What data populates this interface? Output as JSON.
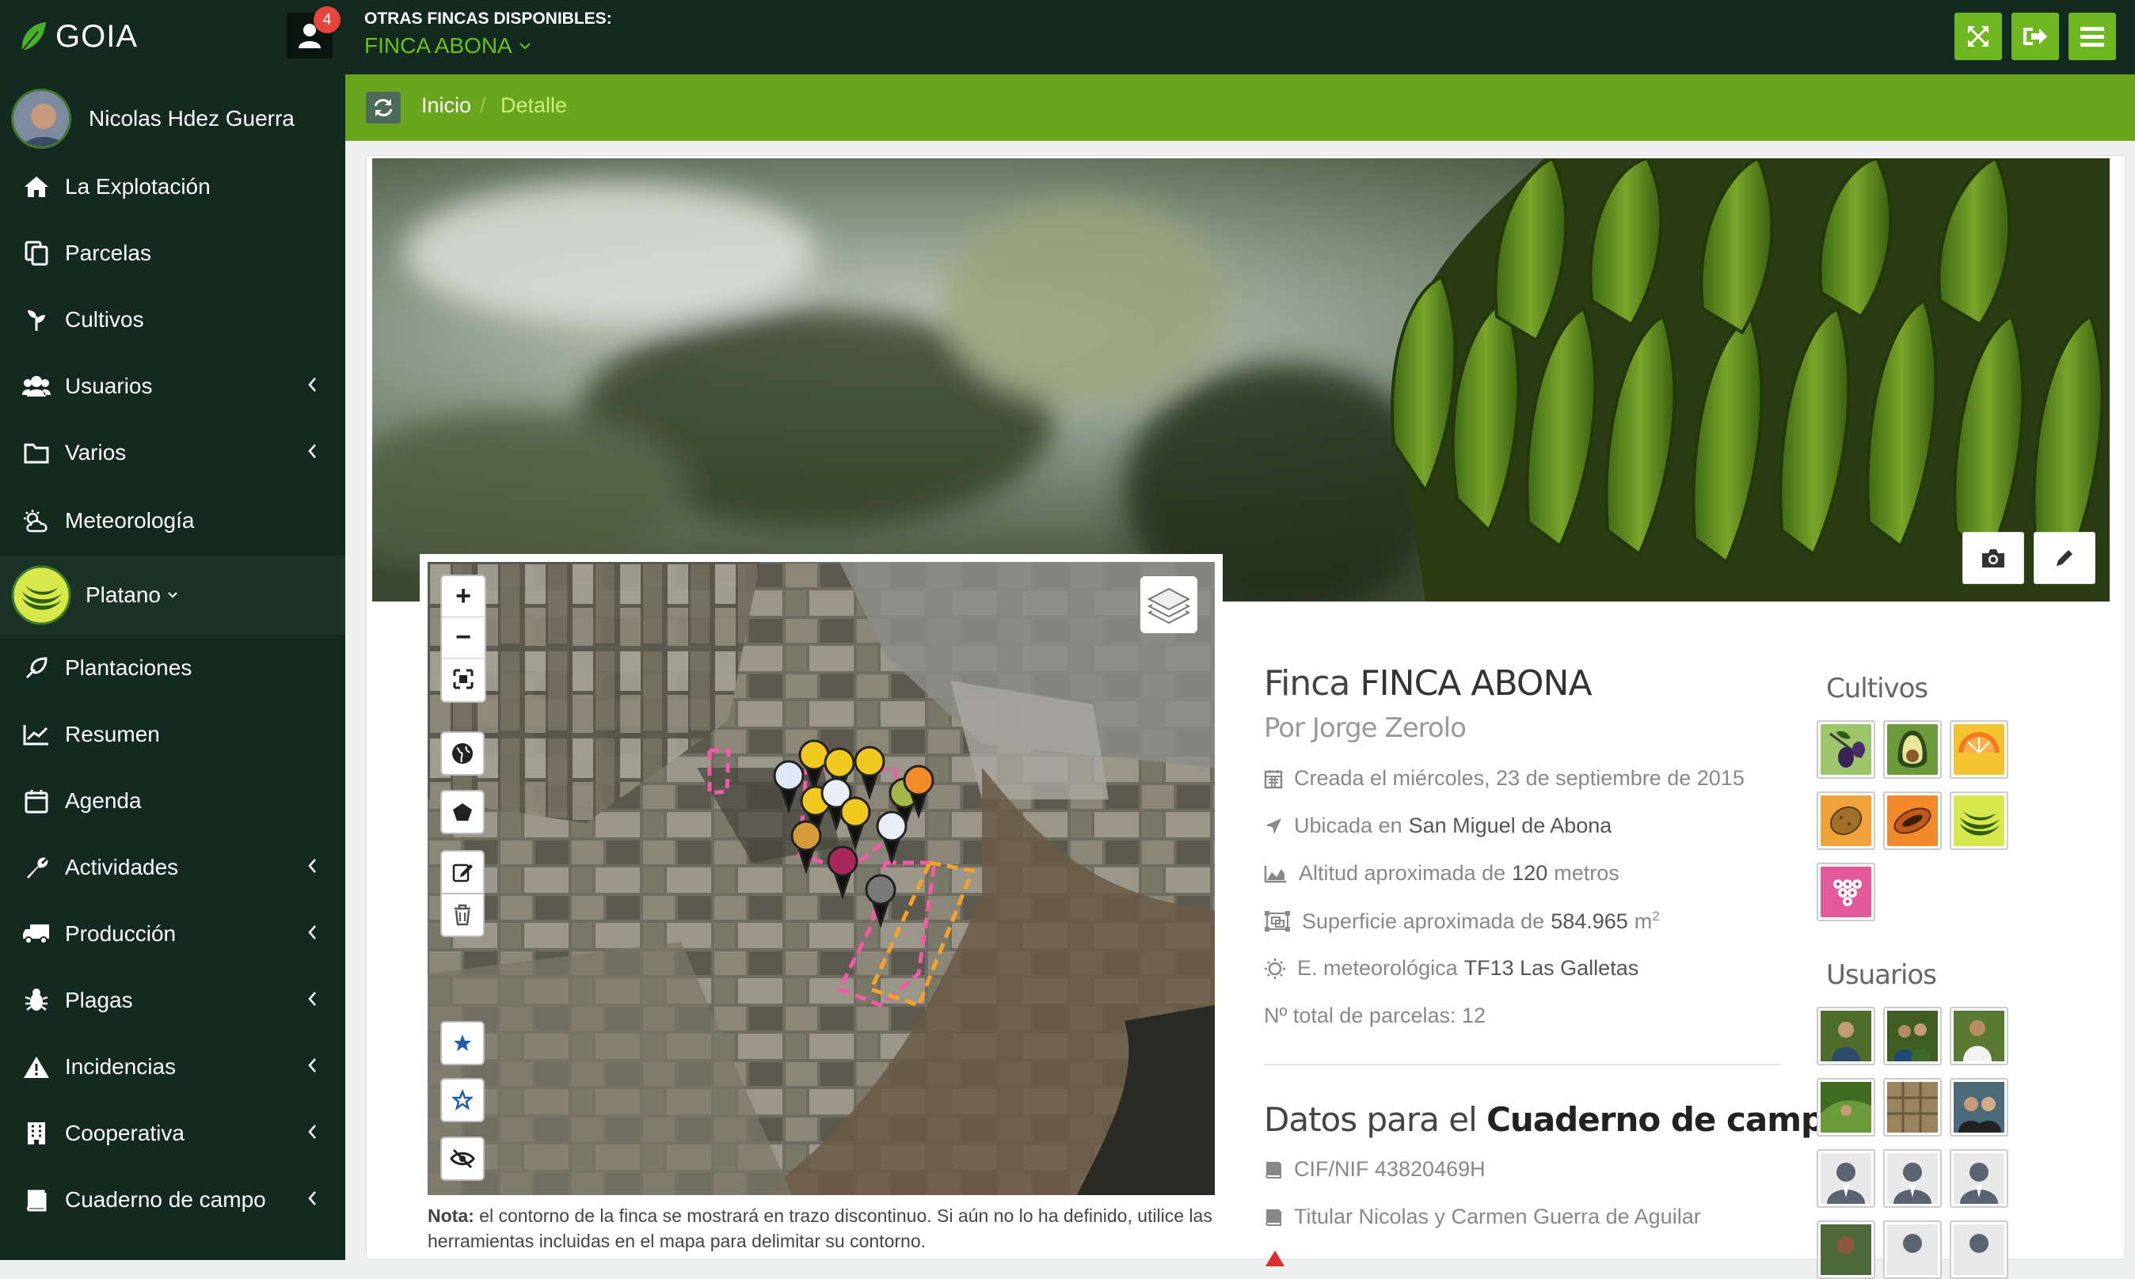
{
  "app": {
    "name": "GOIA",
    "notifications": "4"
  },
  "farm_selector": {
    "label": "OTRAS FINCAS DISPONIBLES:",
    "value": "FINCA ABONA"
  },
  "sidebar": {
    "user_name": "Nicolas Hdez Guerra",
    "items": [
      {
        "label": "La Explotación",
        "icon": "home-icon"
      },
      {
        "label": "Parcelas",
        "icon": "copy-icon"
      },
      {
        "label": "Cultivos",
        "icon": "sprout-icon"
      },
      {
        "label": "Usuarios",
        "icon": "users-icon"
      },
      {
        "label": "Varios",
        "icon": "folder-icon"
      },
      {
        "label": "Meteorología",
        "icon": "weather-icon"
      },
      {
        "label": "Platano",
        "icon": "banana-icon"
      },
      {
        "label": "Plantaciones",
        "icon": "plant-icon"
      },
      {
        "label": "Resumen",
        "icon": "line-chart-icon"
      },
      {
        "label": "Agenda",
        "icon": "calendar-icon"
      },
      {
        "label": "Actividades",
        "icon": "wrench-icon"
      },
      {
        "label": "Producción",
        "icon": "truck-icon"
      },
      {
        "label": "Plagas",
        "icon": "bug-icon"
      },
      {
        "label": "Incidencias",
        "icon": "warning-icon"
      },
      {
        "label": "Cooperativa",
        "icon": "building-icon"
      },
      {
        "label": "Cuaderno de campo",
        "icon": "book-icon"
      }
    ]
  },
  "breadcrumb": {
    "home": "Inicio",
    "separator": "/",
    "current": "Detalle"
  },
  "map": {
    "zoom_in": "+",
    "zoom_out": "−"
  },
  "note": {
    "label": "Nota:",
    "text": "el contorno de la finca se mostrará en trazo discontinuo. Si aún no lo ha definido, utilice las herramientas incluidas en el mapa para delimitar su contorno."
  },
  "farm": {
    "title_prefix": "Finca",
    "title_name": "FINCA ABONA",
    "owner": "Por Jorge Zerolo",
    "created_label": "Creada el miércoles, 23 de septiembre de 2015",
    "location_label": "Ubicada en",
    "location_value": "San Miguel de Abona",
    "altitude_label": "Altitud aproximada de",
    "altitude_value": "120",
    "altitude_unit": "metros",
    "surface_label": "Superficie aproximada de",
    "surface_value": "584.965",
    "surface_unit": "m",
    "surface_exp": "2",
    "station_label": "E. meteorológica",
    "station_value": "TF13 Las Galletas",
    "parcels_label": "Nº total de parcelas: 12"
  },
  "cuaderno": {
    "title_prefix": "Datos para el",
    "title_bold": "Cuaderno de campo",
    "cif": "CIF/NIF 43820469H",
    "titular": "Titular Nicolas y Carmen Guerra de Aguilar"
  },
  "cultivos": {
    "heading": "Cultivos",
    "items": [
      "olive",
      "avocado",
      "orange",
      "potato",
      "papaya",
      "banana",
      "grape"
    ]
  },
  "usuarios": {
    "heading": "Usuarios"
  },
  "colors": {
    "brand_green": "#6aa51f",
    "dark": "#14291f",
    "badge": "#e6443c"
  }
}
